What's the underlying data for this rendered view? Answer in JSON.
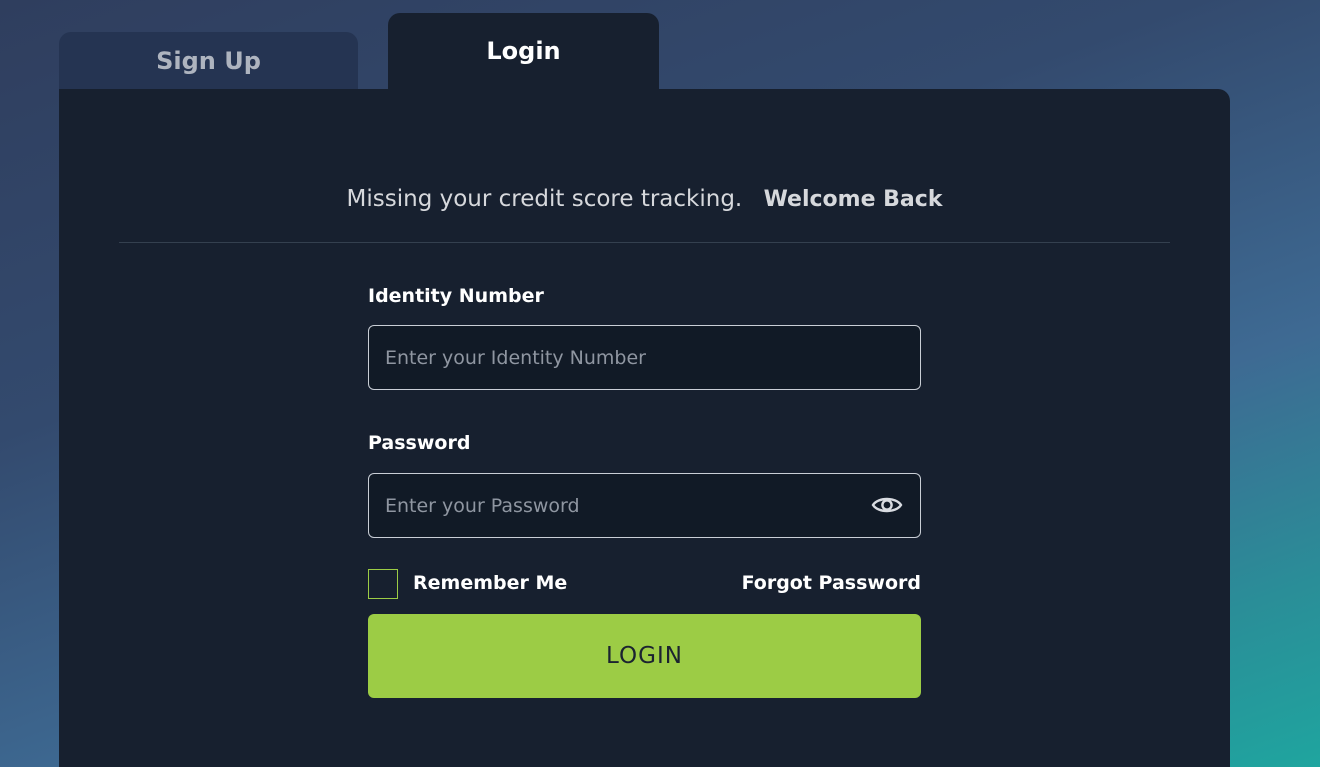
{
  "tabs": {
    "signup_label": "Sign Up",
    "login_label": "Login",
    "active": "Login"
  },
  "header": {
    "subtitle": "Missing your credit score tracking.",
    "welcome": "Welcome Back"
  },
  "form": {
    "identity": {
      "label": "Identity Number",
      "placeholder": "Enter your Identity Number",
      "value": ""
    },
    "password": {
      "label": "Password",
      "placeholder": "Enter your Password",
      "value": "",
      "toggle_icon": "eye-icon"
    },
    "remember": {
      "label": "Remember Me",
      "checked": false
    },
    "forgot_label": "Forgot Password",
    "submit_label": "LOGIN"
  },
  "colors": {
    "accent": "#9ccc45",
    "card_bg": "#17202f",
    "inactive_tab_bg": "#253452"
  }
}
